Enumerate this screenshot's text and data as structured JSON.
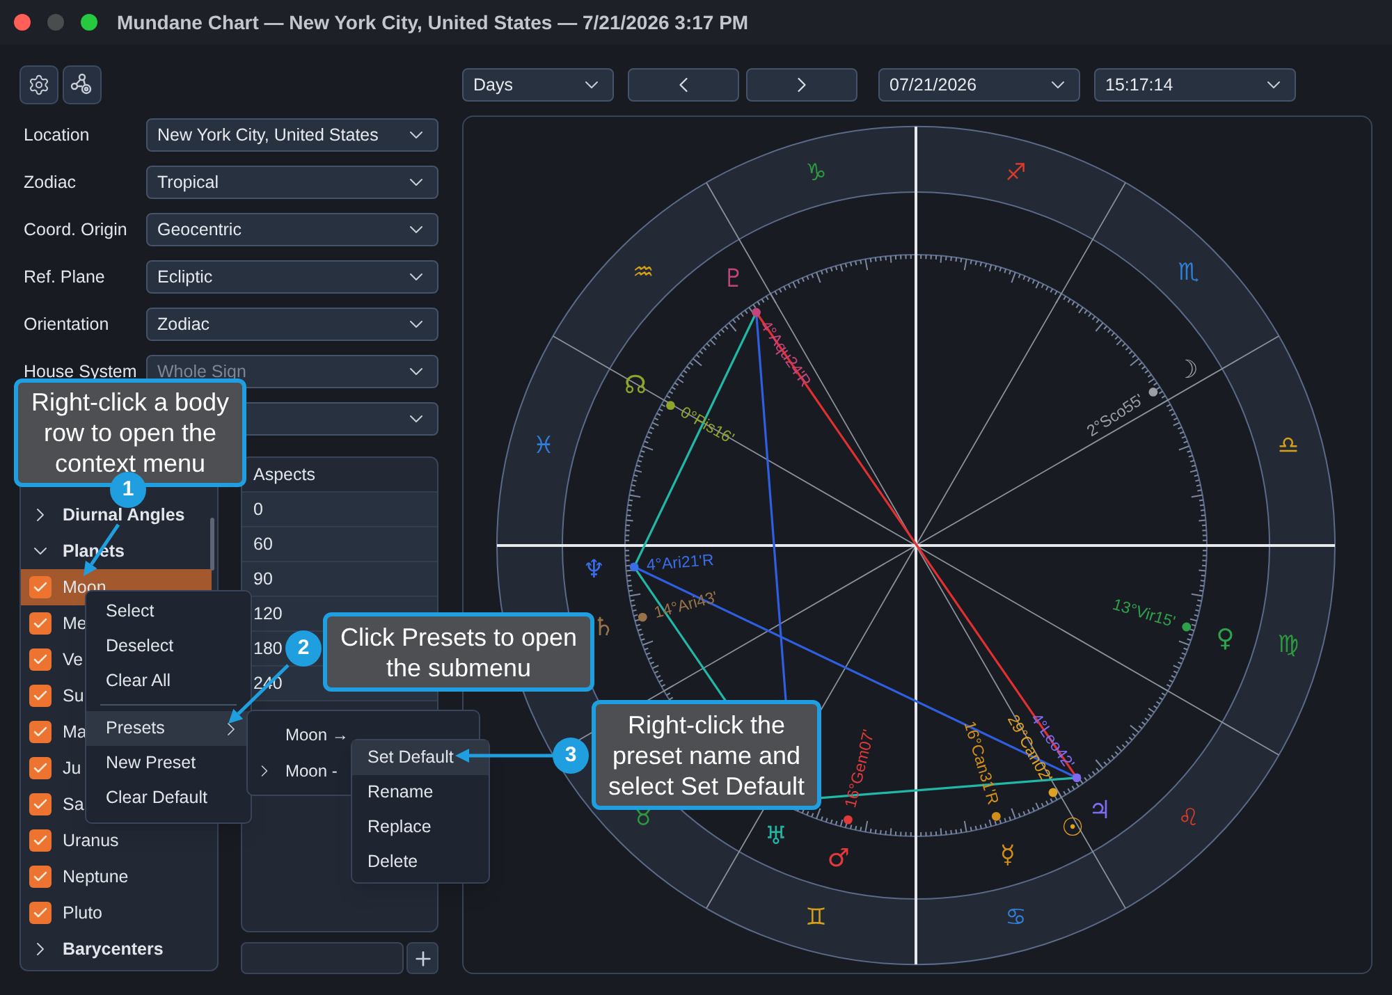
{
  "window": {
    "title": "Mundane Chart — New York City, United States — 7/21/2026 3:17 PM"
  },
  "settings": [
    {
      "label": "Location",
      "value": "New York City, United States",
      "disabled": false
    },
    {
      "label": "Zodiac",
      "value": "Tropical",
      "disabled": false
    },
    {
      "label": "Coord. Origin",
      "value": "Geocentric",
      "disabled": false
    },
    {
      "label": "Ref. Plane",
      "value": "Ecliptic",
      "disabled": false
    },
    {
      "label": "Orientation",
      "value": "Zodiac",
      "disabled": false
    },
    {
      "label": "House System",
      "value": "Whole Sign",
      "disabled": true
    }
  ],
  "bodies": [
    {
      "kind": "group",
      "label": "Diurnal Angles",
      "expanded": false
    },
    {
      "kind": "group",
      "label": "Planets",
      "expanded": true
    },
    {
      "kind": "body",
      "label": "Moon",
      "checked": true,
      "selected": true
    },
    {
      "kind": "body",
      "label": "Me",
      "checked": true,
      "selected": false
    },
    {
      "kind": "body",
      "label": "Ve",
      "checked": true,
      "selected": false
    },
    {
      "kind": "body",
      "label": "Su",
      "checked": true,
      "selected": false
    },
    {
      "kind": "body",
      "label": "Ma",
      "checked": true,
      "selected": false
    },
    {
      "kind": "body",
      "label": "Ju",
      "checked": true,
      "selected": false
    },
    {
      "kind": "body",
      "label": "Sa",
      "checked": true,
      "selected": false
    },
    {
      "kind": "body",
      "label": "Uranus",
      "checked": true,
      "selected": false
    },
    {
      "kind": "body",
      "label": "Neptune",
      "checked": true,
      "selected": false
    },
    {
      "kind": "body",
      "label": "Pluto",
      "checked": true,
      "selected": false
    },
    {
      "kind": "group",
      "label": "Barycenters",
      "expanded": false
    }
  ],
  "aspects": {
    "header": "Aspects",
    "rows": [
      "0",
      "60",
      "90",
      "120",
      "180",
      "240"
    ]
  },
  "time_controls": {
    "step": "Days",
    "date": "07/21/2026",
    "time": "15:17:14"
  },
  "chart": {
    "signs": [
      {
        "glyph": "♑",
        "color": "#2e9a3e"
      },
      {
        "glyph": "♐",
        "color": "#d83a2a"
      },
      {
        "glyph": "♏",
        "color": "#2f7fd8"
      },
      {
        "glyph": "♎",
        "color": "#d4a017"
      },
      {
        "glyph": "♍",
        "color": "#2e9a3e"
      },
      {
        "glyph": "♌",
        "color": "#d83a2a"
      },
      {
        "glyph": "♋",
        "color": "#2f7fd8"
      },
      {
        "glyph": "♊",
        "color": "#d4a017"
      },
      {
        "glyph": "♉",
        "color": "#2e9a3e"
      },
      {
        "glyph": "♓",
        "color": "#2f7fd8"
      },
      {
        "glyph": "♒",
        "color": "#d4a017"
      }
    ],
    "planets": [
      {
        "glyph": "♇",
        "label": "4°Aqu24'R",
        "color": "#c2457c"
      },
      {
        "glyph": "☊",
        "label": "0°Pis16'",
        "color": "#8ea52a"
      },
      {
        "glyph": "☽",
        "label": "2°Sco55'",
        "color": "#9a9ea6"
      },
      {
        "glyph": "♆",
        "label": "4°Ari21'R",
        "color": "#3a6ee8"
      },
      {
        "glyph": "♄",
        "label": "14°Ari43'",
        "color": "#9a7248"
      },
      {
        "glyph": "♀",
        "label": "13°Vir15'",
        "color": "#2ea14a"
      },
      {
        "glyph": "♃",
        "label": "4°Leo42'",
        "color": "#7c6cf0"
      },
      {
        "glyph": "☉",
        "label": "29°Can02'",
        "color": "#e0a020"
      },
      {
        "glyph": "☿",
        "label": "16°Can31'R",
        "color": "#d18f1a"
      },
      {
        "glyph": "♂",
        "label": "16°Gem07'",
        "color": "#e03a3a"
      },
      {
        "glyph": "♅",
        "color": "#21b5a5"
      }
    ]
  },
  "context_menu": [
    {
      "kind": "item",
      "label": "Select",
      "highlighted": false
    },
    {
      "kind": "item",
      "label": "Deselect",
      "highlighted": false
    },
    {
      "kind": "item",
      "label": "Clear All",
      "highlighted": false
    },
    {
      "kind": "separator"
    },
    {
      "kind": "submenu",
      "label": "Presets",
      "highlighted": true
    },
    {
      "kind": "item",
      "label": "New Preset",
      "highlighted": false
    },
    {
      "kind": "item",
      "label": "Clear Default",
      "highlighted": false
    }
  ],
  "presets_submenu": [
    {
      "label": "Moon →",
      "expandable": false
    },
    {
      "label": "Moon -",
      "expandable": true
    }
  ],
  "preset_menu": [
    {
      "label": "Set Default",
      "highlighted": true
    },
    {
      "label": "Rename",
      "highlighted": false
    },
    {
      "label": "Replace",
      "highlighted": false
    },
    {
      "label": "Delete",
      "highlighted": false
    }
  ],
  "callouts": [
    {
      "number": "1",
      "text": "Right-click a body row to open the context menu"
    },
    {
      "number": "2",
      "text": "Click Presets to open the submenu"
    },
    {
      "number": "3",
      "text": "Right-click the preset name and select Set Default"
    }
  ]
}
